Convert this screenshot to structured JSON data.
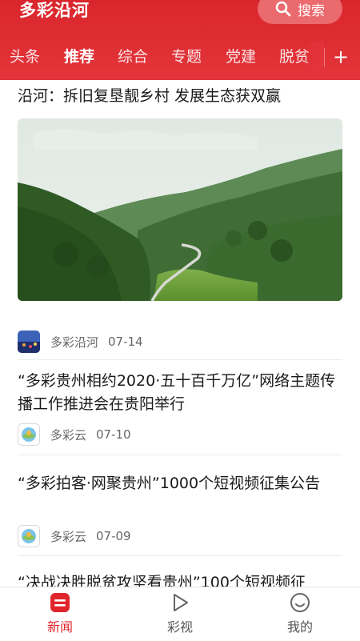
{
  "header": {
    "app_title": "多彩沿河",
    "search_label": "搜索"
  },
  "tabs": [
    {
      "label": "头条",
      "active": false
    },
    {
      "label": "推荐",
      "active": true
    },
    {
      "label": "综合",
      "active": false
    },
    {
      "label": "专题",
      "active": false
    },
    {
      "label": "党建",
      "active": false
    },
    {
      "label": "脱贫",
      "active": false
    }
  ],
  "add_tab_label": "+",
  "articles": [
    {
      "title": "沿河：拆旧复垦靓乡村 发展生态获双赢",
      "source": "多彩沿河",
      "date": "07-14"
    },
    {
      "title": "“多彩贵州相约2020·五十百千万亿”网络主题传播工作推进会在贵阳举行",
      "source": "多彩云",
      "date": "07-10"
    },
    {
      "title": "“多彩拍客·网聚贵州”1000个短视频征集公告",
      "source": "多彩云",
      "date": "07-09"
    },
    {
      "title": "“决战决胜脱贫攻坚看贵州”100个短视频征"
    }
  ],
  "bottom_nav": [
    {
      "label": "新闻",
      "active": true
    },
    {
      "label": "彩视",
      "active": false
    },
    {
      "label": "我的",
      "active": false
    }
  ],
  "colors": {
    "brand_red": "#e0262c",
    "header_red": "#d9262c",
    "text_dark": "#1a1a1a",
    "text_meta": "#666666"
  }
}
